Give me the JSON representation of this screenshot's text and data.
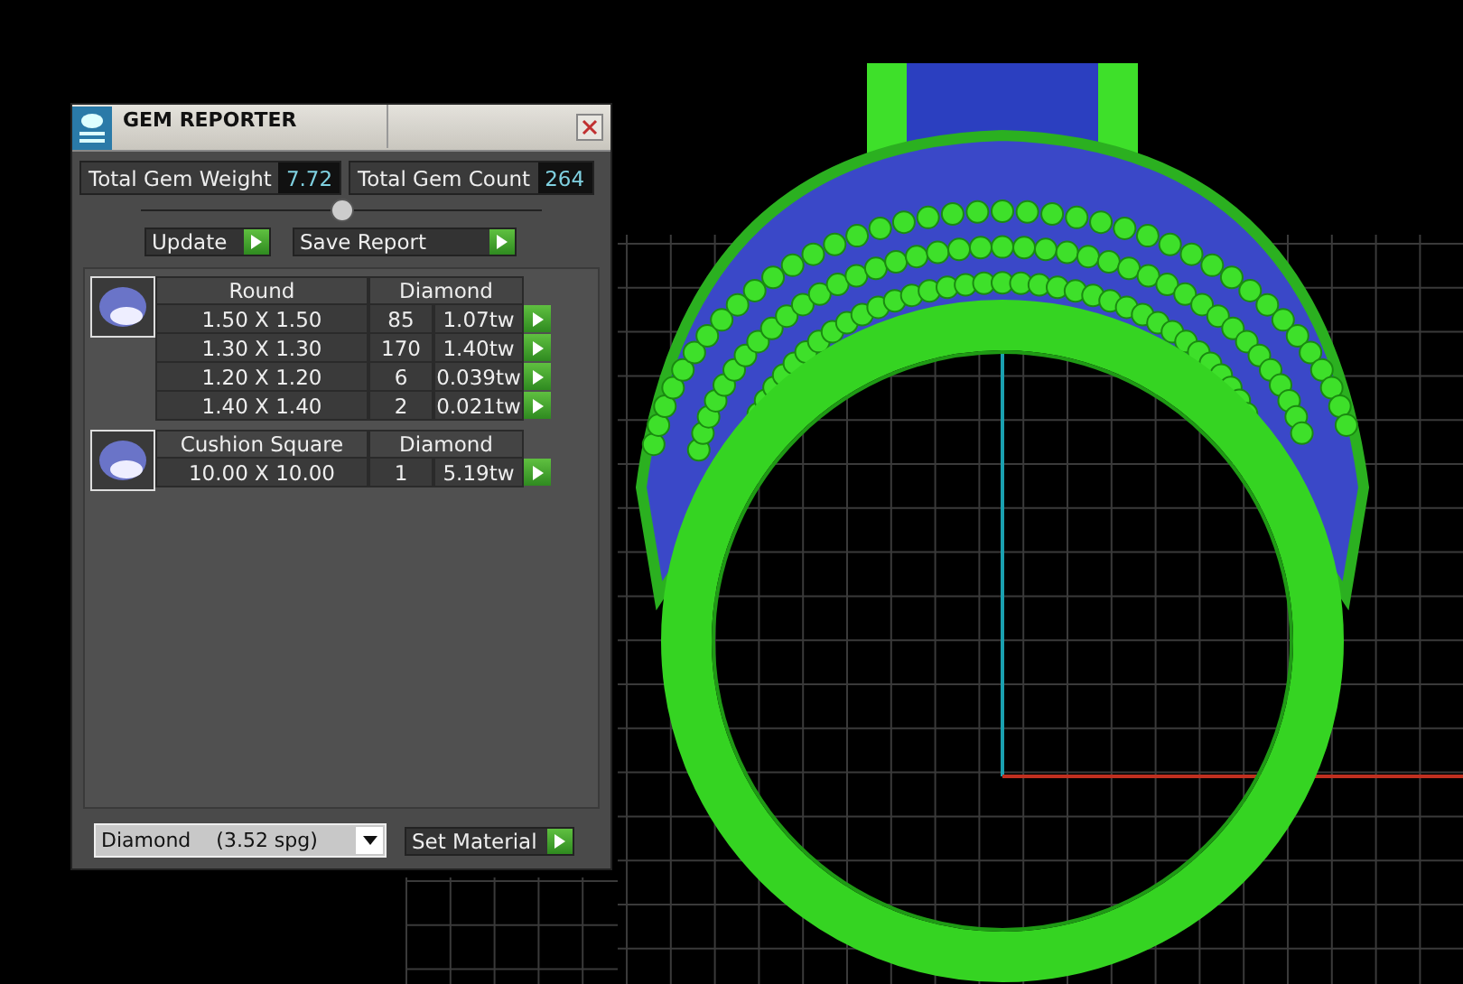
{
  "window": {
    "title": "GEM REPORTER"
  },
  "totals": [
    {
      "label": "Total Gem Weight",
      "value": "7.72"
    },
    {
      "label": "Total Gem Count",
      "value": "264"
    }
  ],
  "buttons": [
    "Update",
    "Save Report"
  ],
  "groups": [
    {
      "shape": "Round",
      "material": "Diamond",
      "rows": [
        {
          "size": "1.50 X 1.50",
          "count": "85",
          "weight": "1.07tw"
        },
        {
          "size": "1.30 X 1.30",
          "count": "170",
          "weight": "1.40tw"
        },
        {
          "size": "1.20 X 1.20",
          "count": "6",
          "weight": "0.039tw"
        },
        {
          "size": "1.40 X 1.40",
          "count": "2",
          "weight": "0.021tw"
        }
      ]
    },
    {
      "shape": "Cushion Square",
      "material": "Diamond",
      "rows": [
        {
          "size": "10.00 X 10.00",
          "count": "1",
          "weight": "5.19tw"
        }
      ]
    }
  ],
  "material_select": {
    "value": "Diamond    (3.52 spg)"
  },
  "set_button": "Set Material"
}
